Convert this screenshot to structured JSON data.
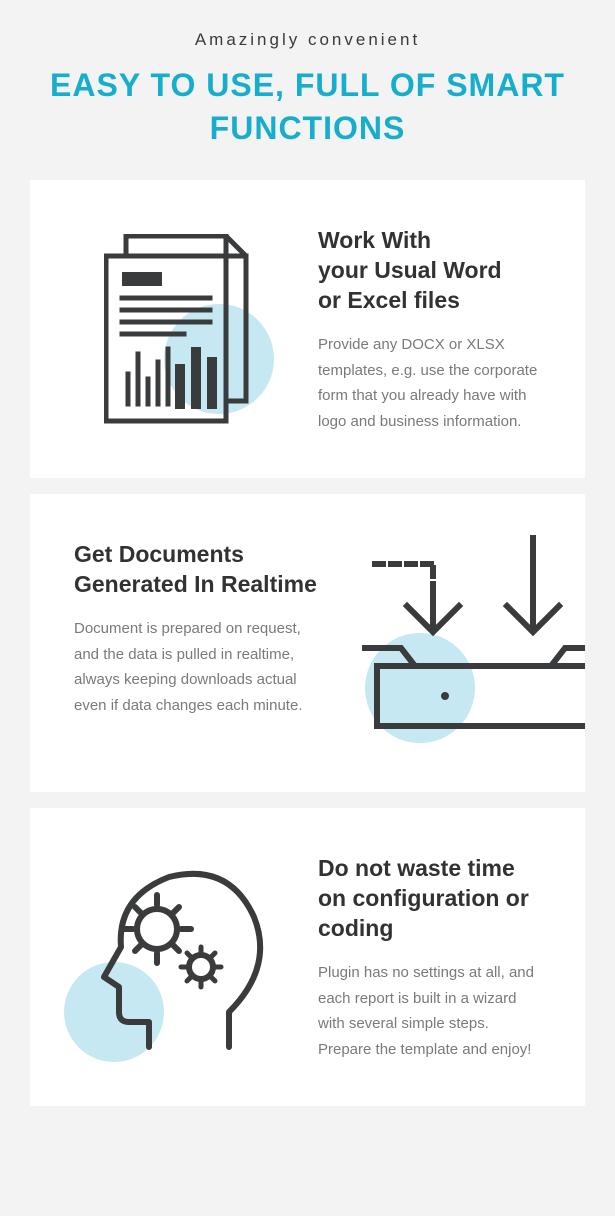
{
  "header": {
    "subtitle": "Amazingly convenient",
    "title": "EASY TO USE, FULL OF SMART FUNCTIONS"
  },
  "cards": [
    {
      "title": "Work With\nyour Usual Word\nor Excel files",
      "body": "Provide any DOCX or XLSX templates, e.g. use the corporate form that you already have with logo and business information."
    },
    {
      "title": "Get Documents Generated In Realtime",
      "body": "Document is prepared on request, and the data is pulled in realtime, always keeping downloads actual even if data changes each minute."
    },
    {
      "title": "Do not waste time on configuration or coding",
      "body": "Plugin has no settings at all, and each report is built in a wizard with several simple steps. Prepare the template and enjoy!"
    }
  ]
}
